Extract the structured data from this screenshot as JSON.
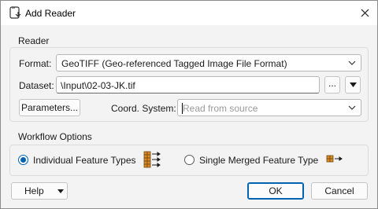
{
  "window": {
    "title": "Add Reader",
    "app_icon": "reader-document-icon",
    "close_icon": "close-icon"
  },
  "reader": {
    "group_label": "Reader",
    "format_label": "Format:",
    "format_value": "GeoTIFF (Geo-referenced Tagged Image File Format)",
    "dataset_label": "Dataset:",
    "dataset_value": "\\Input\\02-03-JK.tif",
    "browse_label": "...",
    "parameters_label": "Parameters...",
    "coord_label": "Coord. System:",
    "coord_placeholder": "Read from source"
  },
  "workflow": {
    "group_label": "Workflow Options",
    "option_individual": "Individual Feature Types",
    "option_individual_selected": true,
    "option_merged": "Single Merged Feature Type",
    "option_merged_selected": false
  },
  "footer": {
    "help_label": "Help",
    "ok_label": "OK",
    "cancel_label": "Cancel"
  },
  "colors": {
    "accent": "#0063b1",
    "icon_brown": "#6b4a1e",
    "icon_orange": "#e08a1c"
  }
}
